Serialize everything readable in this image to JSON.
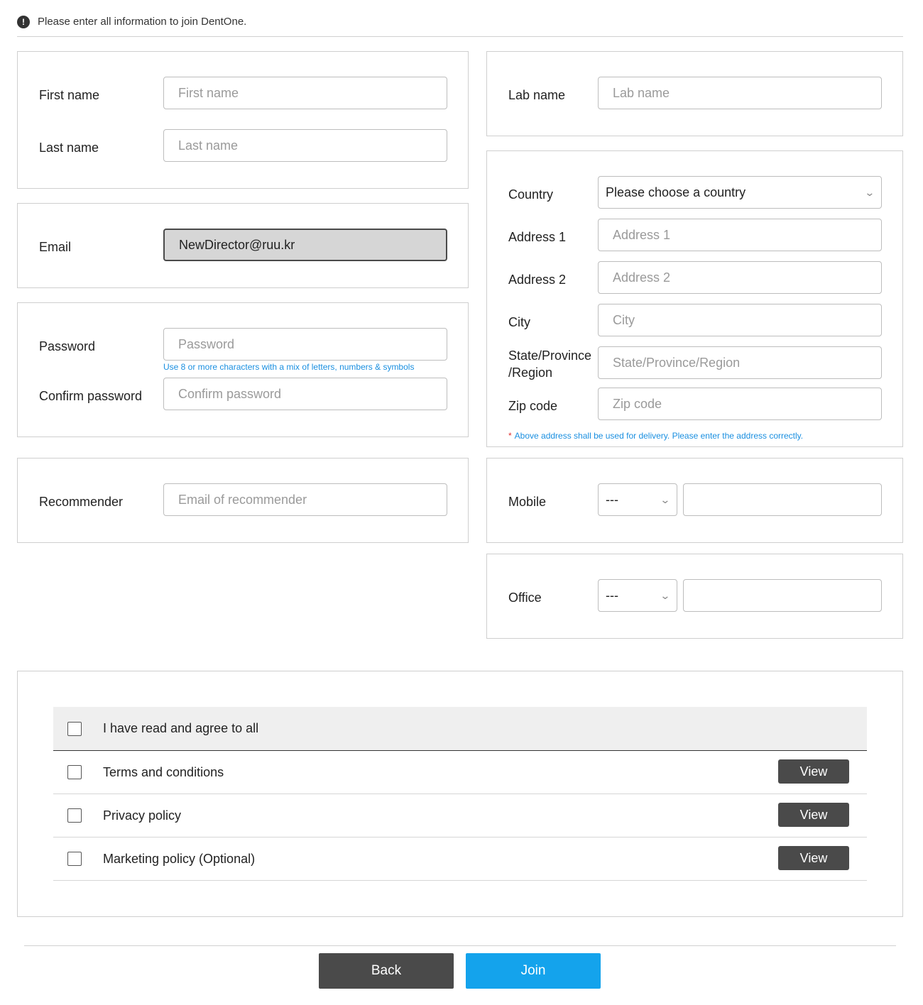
{
  "notice": {
    "icon": "exclamation-icon",
    "text": "Please enter all information to join DentOne."
  },
  "name": {
    "first_label": "First name",
    "first_placeholder": "First name",
    "last_label": "Last name",
    "last_placeholder": "Last name"
  },
  "email": {
    "label": "Email",
    "value": "NewDirector@ruu.kr"
  },
  "password": {
    "label": "Password",
    "placeholder": "Password",
    "hint": "Use 8 or more characters with a mix of letters, numbers & symbols",
    "confirm_label": "Confirm password",
    "confirm_placeholder": "Confirm password"
  },
  "recommender": {
    "label": "Recommender",
    "placeholder": "Email of recommender"
  },
  "lab": {
    "label": "Lab name",
    "placeholder": "Lab name"
  },
  "address": {
    "country_label": "Country",
    "country_value": "Please choose a country",
    "address1_label": "Address 1",
    "address1_placeholder": "Address 1",
    "address2_label": "Address 2",
    "address2_placeholder": "Address 2",
    "city_label": "City",
    "city_placeholder": "City",
    "state_label_line1": "State/Province",
    "state_label_line2": "/Region",
    "state_placeholder": "State/Province/Region",
    "zip_label": "Zip code",
    "zip_placeholder": "Zip code",
    "note_star": "*",
    "note": "Above address shall be used for delivery. Please enter the address correctly."
  },
  "mobile": {
    "label": "Mobile",
    "code_value": "---",
    "number_value": ""
  },
  "office": {
    "label": "Office",
    "code_value": "---",
    "number_value": ""
  },
  "agreements": {
    "all_label": "I have read and agree to all",
    "items": [
      {
        "label": "Terms and conditions",
        "button": "View"
      },
      {
        "label": "Privacy policy",
        "button": "View"
      },
      {
        "label": "Marketing policy (Optional)",
        "button": "View"
      }
    ]
  },
  "footer": {
    "back_label": "Back",
    "join_label": "Join"
  }
}
